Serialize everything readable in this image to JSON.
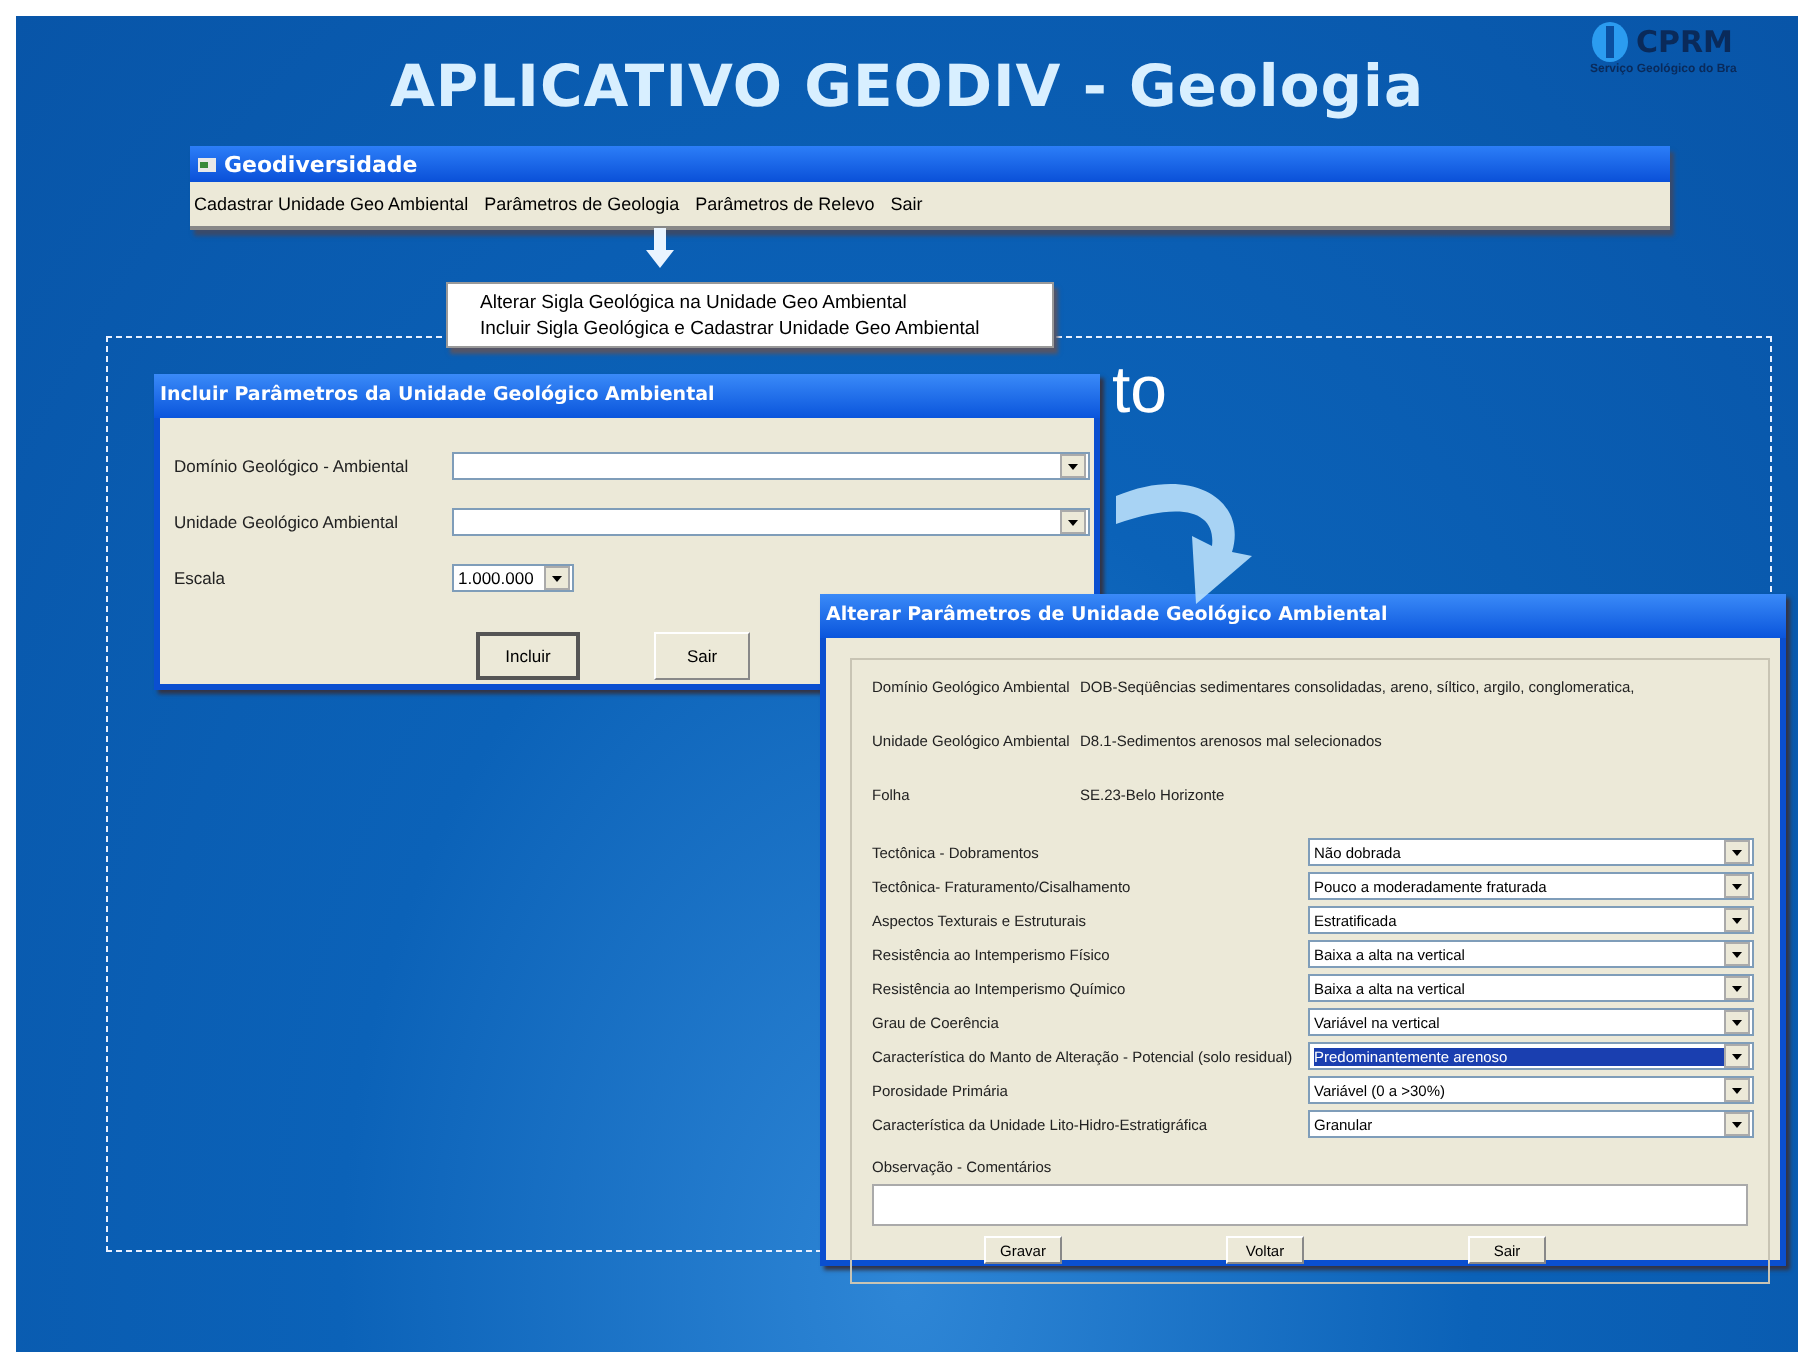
{
  "slide": {
    "title": "APLICATIVO GEODIV - Geologia",
    "logo": {
      "name": "CPRM",
      "subtitle": "Serviço Geológico do Bra"
    },
    "partial_heading": "to"
  },
  "main_window": {
    "title": "Geodiversidade",
    "menu": [
      {
        "label": "Cadastrar Unidade Geo Ambiental"
      },
      {
        "label": "Parâmetros de Geologia"
      },
      {
        "label": "Parâmetros de Relevo"
      },
      {
        "label": "Sair"
      }
    ]
  },
  "menu_dropdown": {
    "items": [
      {
        "label": "Alterar Sigla Geológica na Unidade Geo Ambiental"
      },
      {
        "label": "Incluir Sigla Geológica e Cadastrar Unidade Geo Ambiental"
      }
    ]
  },
  "include_dialog": {
    "title": "Incluir Parâmetros da Unidade Geológico Ambiental",
    "fields": [
      {
        "label": "Domínio Geológico - Ambiental",
        "kind": "wide"
      },
      {
        "label": "Unidade Geológico Ambiental",
        "kind": "wide"
      },
      {
        "label": "Escala",
        "kind": "narrow",
        "value": "1.000.000"
      }
    ],
    "buttons": [
      {
        "label": "Incluir",
        "default": true
      },
      {
        "label": "Sair",
        "default": false
      }
    ]
  },
  "edit_dialog": {
    "title": "Alterar Parâmetros de Unidade Geológico Ambiental",
    "info": [
      {
        "label": "Domínio Geológico Ambiental",
        "value": "DOB-Seqüências sedimentares consolidadas, areno, síltico, argilo, conglomeratica,"
      },
      {
        "label": "Unidade Geológico Ambiental",
        "value": "D8.1-Sedimentos arenosos mal selecionados"
      },
      {
        "label": "Folha",
        "value": "SE.23-Belo Horizonte"
      }
    ],
    "params": [
      {
        "label": "Tectônica - Dobramentos",
        "value": "Não dobrada",
        "selected": false
      },
      {
        "label": "Tectônica- Fraturamento/Cisalhamento",
        "value": "Pouco a moderadamente fraturada",
        "selected": false
      },
      {
        "label": "Aspectos Texturais e Estruturais",
        "value": "Estratificada",
        "selected": false
      },
      {
        "label": "Resistência ao Intemperismo Físico",
        "value": "Baixa a alta na vertical",
        "selected": false
      },
      {
        "label": "Resistência ao Intemperismo Químico",
        "value": "Baixa a alta na vertical",
        "selected": false
      },
      {
        "label": "Grau de Coerência",
        "value": "Variável na vertical",
        "selected": false
      },
      {
        "label": "Característica do Manto de Alteração - Potencial (solo residual)",
        "value": "Predominantemente arenoso",
        "selected": true
      },
      {
        "label": "Porosidade Primária",
        "value": "Variável (0 a >30%)",
        "selected": false
      },
      {
        "label": "Característica da Unidade Lito-Hidro-Estratigráfica",
        "value": "Granular",
        "selected": false
      }
    ],
    "observation": {
      "label": "Observação - Comentários"
    },
    "buttons": [
      {
        "label": "Gravar"
      },
      {
        "label": "Voltar"
      },
      {
        "label": "Sair"
      }
    ]
  }
}
